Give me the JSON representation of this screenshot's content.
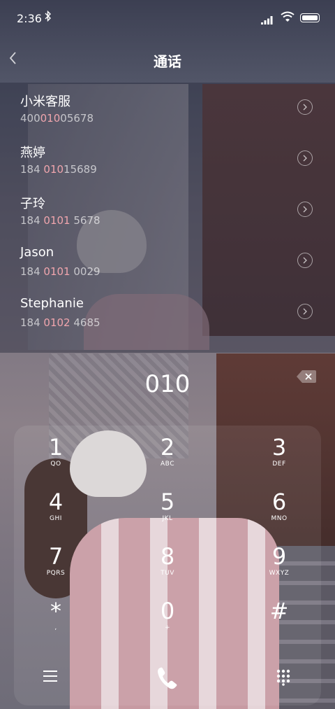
{
  "status": {
    "time": "2:36"
  },
  "header": {
    "title": "通话"
  },
  "results": [
    {
      "name": "小米客服",
      "num_pre": "400",
      "num_hl": "010",
      "num_post": "05678"
    },
    {
      "name": "燕婷",
      "num_pre": "184 ",
      "num_hl": "010",
      "num_post": "15689"
    },
    {
      "name": "子玲",
      "num_pre": "184 ",
      "num_hl": "0101",
      "num_post": " 5678"
    },
    {
      "name": "Jason",
      "num_pre": "184 ",
      "num_hl": "0101",
      "num_post": " 0029"
    },
    {
      "name": "Stephanie",
      "num_pre": "184 ",
      "num_hl": "0102",
      "num_post": " 4685"
    }
  ],
  "dialer": {
    "digits": "010",
    "keys": [
      {
        "d": "1",
        "l": "QO"
      },
      {
        "d": "2",
        "l": "ABC"
      },
      {
        "d": "3",
        "l": "DEF"
      },
      {
        "d": "4",
        "l": "GHI"
      },
      {
        "d": "5",
        "l": "JKL"
      },
      {
        "d": "6",
        "l": "MNO"
      },
      {
        "d": "7",
        "l": "PQRS"
      },
      {
        "d": "8",
        "l": "TUV"
      },
      {
        "d": "9",
        "l": "WXYZ"
      },
      {
        "d": "*",
        "l": ","
      },
      {
        "d": "0",
        "l": "+"
      },
      {
        "d": "#",
        "l": ""
      }
    ]
  },
  "icons": {
    "back": "chevron-left-icon",
    "row_action": "chevron-right-circle-icon",
    "backspace": "backspace-icon",
    "menu": "menu-icon",
    "call": "phone-icon",
    "keypad": "keypad-icon"
  },
  "colors": {
    "highlight": "#f0a5ad"
  }
}
